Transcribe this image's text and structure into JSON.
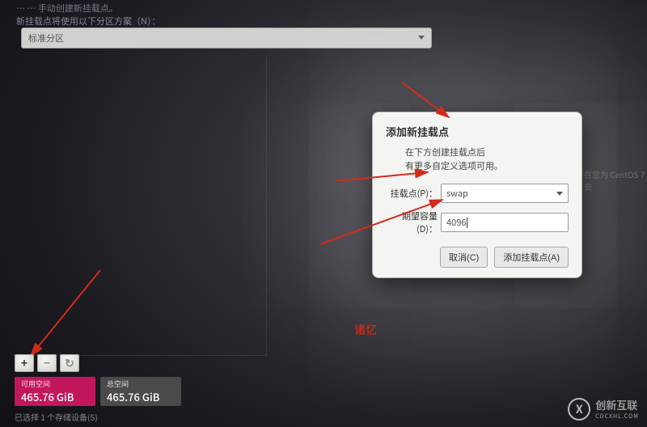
{
  "top": {
    "hint_truncated": "…  … 手动创建新挂载点。",
    "scheme_label": "新挂载点将使用以下分区方案（N）：",
    "scheme_value": "标准分区"
  },
  "right_hint": "在您为 CentOS 7 安",
  "dialog": {
    "title": "添加新挂载点",
    "sub_line1": "在下方创建挂载点后",
    "sub_line2": "有更多自定义选项可用。",
    "mount_label": "挂载点(P)：",
    "mount_value": "swap",
    "size_label": "期望容量(D)：",
    "size_value": "4096",
    "cancel": "取消(C)",
    "confirm": "添加挂载点(A)"
  },
  "annotation": {
    "red_text": "诸忆"
  },
  "toolbar": {
    "tools": [
      {
        "name": "add-mountpoint-button",
        "glyph": "+"
      },
      {
        "name": "remove-mountpoint-button",
        "glyph": "−"
      },
      {
        "name": "reload-button",
        "glyph": "↻"
      }
    ]
  },
  "disks": {
    "available": {
      "label": "可用空间",
      "value": "465.76 GiB"
    },
    "total": {
      "label": "总空间",
      "value": "465.76 GiB"
    },
    "count_text": "已选择 1 个存储设备(S)"
  },
  "watermark": {
    "glyph": "X",
    "name": "创新互联",
    "sub": "CDCXHL.COM"
  }
}
